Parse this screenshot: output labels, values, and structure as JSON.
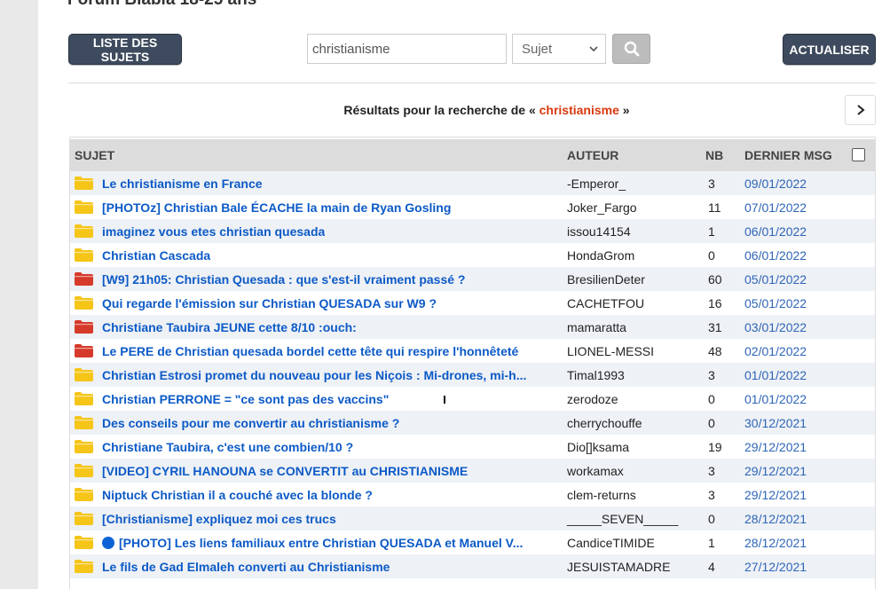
{
  "forum_title": "Forum Blabla 18-25 ans",
  "toolbar": {
    "list_label": "LISTE DES SUJETS",
    "search_value": "christianisme",
    "search_scope": "Sujet",
    "refresh_label": "ACTUALISER"
  },
  "results": {
    "prefix": "Résultats pour la recherche de «",
    "term": "christianisme",
    "suffix": "»"
  },
  "table": {
    "headers": {
      "sujet": "SUJET",
      "auteur": "AUTEUR",
      "nb": "NB",
      "dernier": "DERNIER MSG"
    },
    "rows": [
      {
        "title": "Le christianisme en France",
        "author": "-Emperor_",
        "nb": "3",
        "date": "09/01/2022",
        "folder": "yellow"
      },
      {
        "title": "[PHOTOz] Christian Bale ÉCACHE la main de Ryan Gosling",
        "author": "Joker_Fargo",
        "nb": "11",
        "date": "07/01/2022",
        "folder": "yellow"
      },
      {
        "title": "imaginez vous etes christian quesada",
        "author": "issou14154",
        "nb": "1",
        "date": "06/01/2022",
        "folder": "yellow"
      },
      {
        "title": "Christian Cascada",
        "author": "HondaGrom",
        "nb": "0",
        "date": "06/01/2022",
        "folder": "yellow"
      },
      {
        "title": "[W9] 21h05: Christian Quesada : que s'est-il vraiment passé ?",
        "author": "BresilienDeter",
        "nb": "60",
        "date": "05/01/2022",
        "folder": "red"
      },
      {
        "title": "Qui regarde l'émission sur Christian QUESADA sur W9 ?",
        "author": "CACHETFOU",
        "nb": "16",
        "date": "05/01/2022",
        "folder": "yellow"
      },
      {
        "title": "Christiane Taubira JEUNE cette 8/10 :ouch:",
        "author": "mamaratta",
        "nb": "31",
        "date": "03/01/2022",
        "folder": "red"
      },
      {
        "title": "Le PERE de Christian quesada bordel cette tête qui respire l'honnêteté",
        "author": "LIONEL-MESSI",
        "nb": "48",
        "date": "02/01/2022",
        "folder": "red"
      },
      {
        "title": "Christian Estrosi promet du nouveau pour les Niçois : Mi-drones, mi-h...",
        "author": "Timal1993",
        "nb": "3",
        "date": "01/01/2022",
        "folder": "yellow"
      },
      {
        "title": "Christian PERRONE = \"ce sont pas des vaccins\"",
        "author": "zerodoze",
        "nb": "0",
        "date": "01/01/2022",
        "folder": "yellow"
      },
      {
        "title": "Des conseils pour me convertir au christianisme ?",
        "author": "cherrychouffe",
        "nb": "0",
        "date": "30/12/2021",
        "folder": "yellow"
      },
      {
        "title": "Christiane Taubira, c'est une combien/10 ?",
        "author": "Dio[]ksama",
        "nb": "19",
        "date": "29/12/2021",
        "folder": "yellow"
      },
      {
        "title": "[VIDEO] CYRIL HANOUNA se CONVERTIT au CHRISTIANISME",
        "author": "workamax",
        "nb": "3",
        "date": "29/12/2021",
        "folder": "yellow"
      },
      {
        "title": "Niptuck Christian il a couché avec la blonde ?",
        "author": "clem-returns",
        "nb": "3",
        "date": "29/12/2021",
        "folder": "yellow"
      },
      {
        "title": "[Christianisme] expliquez moi ces trucs",
        "author": "_____SEVEN_____",
        "nb": "0",
        "date": "28/12/2021",
        "folder": "yellow"
      },
      {
        "title": "[PHOTO] Les liens familiaux entre Christian QUESADA et Manuel V...",
        "author": "CandiceTIMIDE",
        "nb": "1",
        "date": "28/12/2021",
        "folder": "yellow",
        "circle": true
      },
      {
        "title": "Le fils de Gad Elmaleh converti au Christianisme",
        "author": "JESUISTAMADRE",
        "nb": "4",
        "date": "27/12/2021",
        "folder": "yellow"
      }
    ]
  },
  "colors": {
    "folder_yellow": "#f5c518",
    "folder_red": "#d63a2a",
    "link": "#0c5ac7",
    "accent": "#d9380c"
  }
}
